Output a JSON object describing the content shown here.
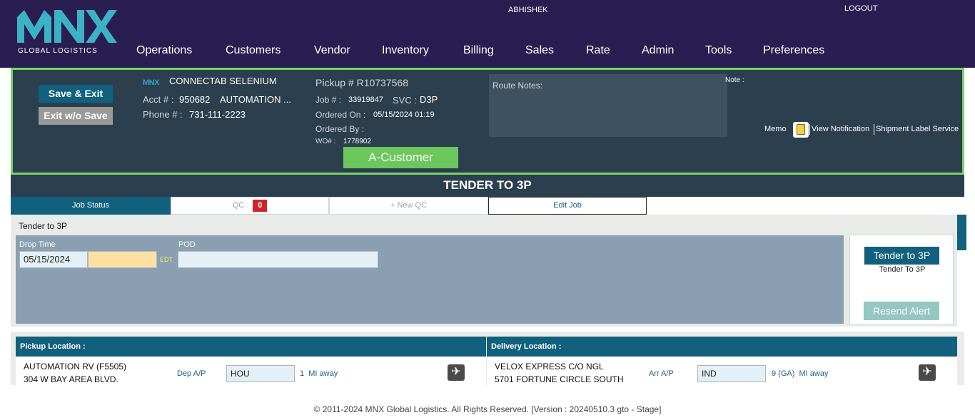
{
  "brand": {
    "logo_text": "MNX",
    "subtitle": "GLOBAL LOGISTICS"
  },
  "user": {
    "name": "ABHISHEK",
    "logout_label": "LOGOUT"
  },
  "nav": [
    "Operations",
    "Customers",
    "Vendor",
    "Inventory",
    "Billing",
    "Sales",
    "Rate",
    "Admin",
    "Tools",
    "Preferences"
  ],
  "job": {
    "save_label": "Save & Exit",
    "exit_label": "Exit w/o Save",
    "mini_logo": "MNX",
    "customer": "CONNECTAB SELENIUM",
    "acct_label": "Acct # :",
    "acct_value": "950682",
    "acct_name": "AUTOMATION ...",
    "phone_label": "Phone # :",
    "phone_value": "731-111-2223",
    "pickup": "Pickup # R10737568",
    "job_label": "Job # :",
    "job_value": "33919847",
    "svc_label": "SVC :",
    "svc_value": "D3P",
    "ordered_on_label": "Ordered On :",
    "ordered_on_value": "05/15/2024 01:19",
    "ordered_by_label": "Ordered By :",
    "wo_label": "WO# :",
    "wo_value": "1778902",
    "route_notes_label": "Route Notes:",
    "note_label": "Note :",
    "customer_type": "A-Customer",
    "memo_label": "Memo",
    "view_notification": "View Notification",
    "shipment_label_service": "Shipment Label Service"
  },
  "title": "TENDER TO 3P",
  "tabs": {
    "job_status": "Job Status",
    "qc": "QC",
    "qc_count": "0",
    "new_qc": "+ New QC",
    "edit_job": "Edit Job"
  },
  "tender": {
    "section_title": "Tender to 3P",
    "drop_time_label": "Drop Time",
    "drop_date": "05/15/2024",
    "timezone": "EDT",
    "pod_label": "POD",
    "tender_button": "Tender to 3P",
    "tender_sub": "Tender To 3P",
    "resend_button": "Resend Alert"
  },
  "pickup_location": {
    "header": "Pickup Location :",
    "line1": "AUTOMATION RV (F5505)",
    "line2": "304 W BAY AREA BLVD.",
    "ap_label": "Dep A/P",
    "ap_value": "HOU",
    "distance": "1",
    "mi_label": "MI away"
  },
  "delivery_location": {
    "header": "Delivery Location :",
    "line1": "VELOX EXPRESS C/O NGL",
    "line2": "5701 FORTUNE CIRCLE SOUTH",
    "ap_label": "Arr A/P",
    "ap_value": "IND",
    "distance": "9 (GA)",
    "mi_label": "MI away"
  },
  "footer": "© 2011-2024 MNX Global Logistics. All Rights Reserved. [Version : 20240510.3 gto - Stage]",
  "colors": {
    "nav_bg": "#291d52",
    "header_bg": "#2b3f4f",
    "accent": "#11607e",
    "green": "#6cc75c",
    "alert": "#d0232c"
  }
}
